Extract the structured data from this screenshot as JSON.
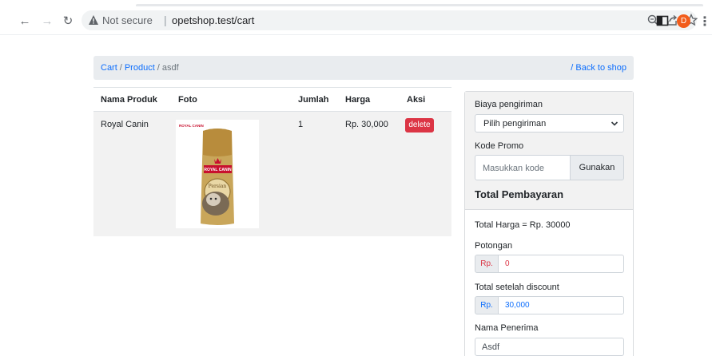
{
  "browser": {
    "security_label": "Not secure",
    "separator": "|",
    "url": "opetshop.test/cart",
    "profile_initial": "D",
    "colors": {
      "profile": "#f25c1b",
      "warning": "#5f6368"
    }
  },
  "breadcrumb": {
    "items": [
      "Cart",
      "Product"
    ],
    "separator": "/",
    "active": "asdf",
    "back_label": "/ Back to shop"
  },
  "cart": {
    "headers": [
      "Nama Produk",
      "Foto",
      "Jumlah",
      "Harga",
      "Aksi"
    ],
    "rows": [
      {
        "name": "Royal Canin",
        "quantity": "1",
        "price": "Rp. 30,000",
        "delete_label": "delete",
        "photo": {
          "brand": "ROYAL CANIN",
          "variant": "Persian"
        }
      }
    ]
  },
  "summary": {
    "shipping_label": "Biaya pengiriman",
    "shipping_select": "Pilih pengiriman",
    "promo_label": "Kode Promo",
    "promo_placeholder": "Masukkan kode",
    "promo_button": "Gunakan",
    "total_title": "Total Pembayaran",
    "total_price_line": "Total Harga = Rp. 30000",
    "discount_label": "Potongan",
    "currency": "Rp.",
    "discount_value": "0",
    "after_discount_label": "Total setelah discount",
    "after_discount_value": "30,000",
    "recipient_label": "Nama Penerima",
    "recipient_value": "Asdf"
  },
  "colors": {
    "link": "#0d6efd",
    "danger": "#dc3545"
  }
}
